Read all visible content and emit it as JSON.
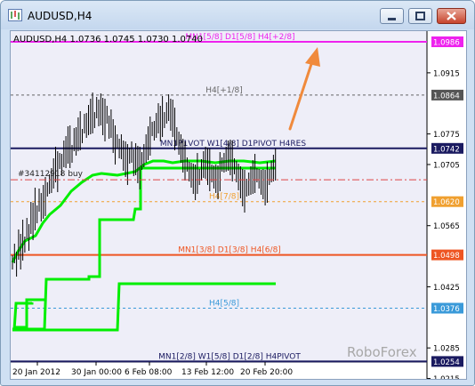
{
  "window": {
    "title": "AUDUSD,H4",
    "icon": "chart-window-icon",
    "buttons": [
      "minimize-icon",
      "restore-icon",
      "close-icon"
    ]
  },
  "chart": {
    "header": "AUDUSD,H4  1.0736 1.0745 1.0730 1.0740",
    "watermark": "RoboForex",
    "order_label": "#34112918 buy",
    "colors": {
      "background": "#eeeef8",
      "price_bars": "#000000",
      "green_line": "#00ee00",
      "arrow": "#f08a3c"
    },
    "levels": [
      {
        "label": "MN1[5/8] D1[5/8] H4[+2/8]",
        "price": "1.0986",
        "value": 1.0986,
        "color": "#ee22ee",
        "style": "solid",
        "badge_bg": "#ee22ee"
      },
      {
        "label": "H4[+1/8]",
        "price": "1.0864",
        "value": 1.0864,
        "color": "#666666",
        "style": "dashed",
        "badge_bg": "#555555"
      },
      {
        "label": "MN1P1VOT W1[4/8] D1PIVOT H4RES",
        "price": "1.0742",
        "value": 1.0742,
        "color": "#1a1a60",
        "style": "solid",
        "badge_bg": "#1a1a60"
      },
      {
        "label": "H4[7/8]",
        "price": "1.0620",
        "value": 1.062,
        "color": "#f0a030",
        "style": "dashed",
        "badge_bg": "#f0a030"
      },
      {
        "label": "MN1[3/8] D1[3/8] H4[6/8]",
        "price": "1.0498",
        "value": 1.0498,
        "color": "#ee5522",
        "style": "solid",
        "badge_bg": "#ee5522"
      },
      {
        "label": "H4[5/8]",
        "price": "1.0376",
        "value": 1.0376,
        "color": "#3a9ad9",
        "style": "dashed",
        "badge_bg": "#3a9ad9"
      },
      {
        "label": "MN1[2/8] W1[5/8] D1[2/8] H4PIVOT",
        "price": "1.0254",
        "value": 1.0254,
        "color": "#1a1a60",
        "style": "solid",
        "badge_bg": "#1a1a60"
      }
    ],
    "order_line": {
      "value": 1.067,
      "color": "#dd4444"
    },
    "y_ticks": [
      "1.0986",
      "1.0915",
      "1.0864",
      "1.0775",
      "1.0742",
      "1.0705",
      "1.0620",
      "1.0565",
      "1.0498",
      "1.0425",
      "1.0376",
      "1.0285",
      "1.0254",
      "1.0215"
    ],
    "x_ticks": [
      "20 Jan 2012",
      "30 Jan 00:00",
      "6 Feb 08:00",
      "13 Feb 12:00",
      "20 Feb 20:00"
    ]
  }
}
